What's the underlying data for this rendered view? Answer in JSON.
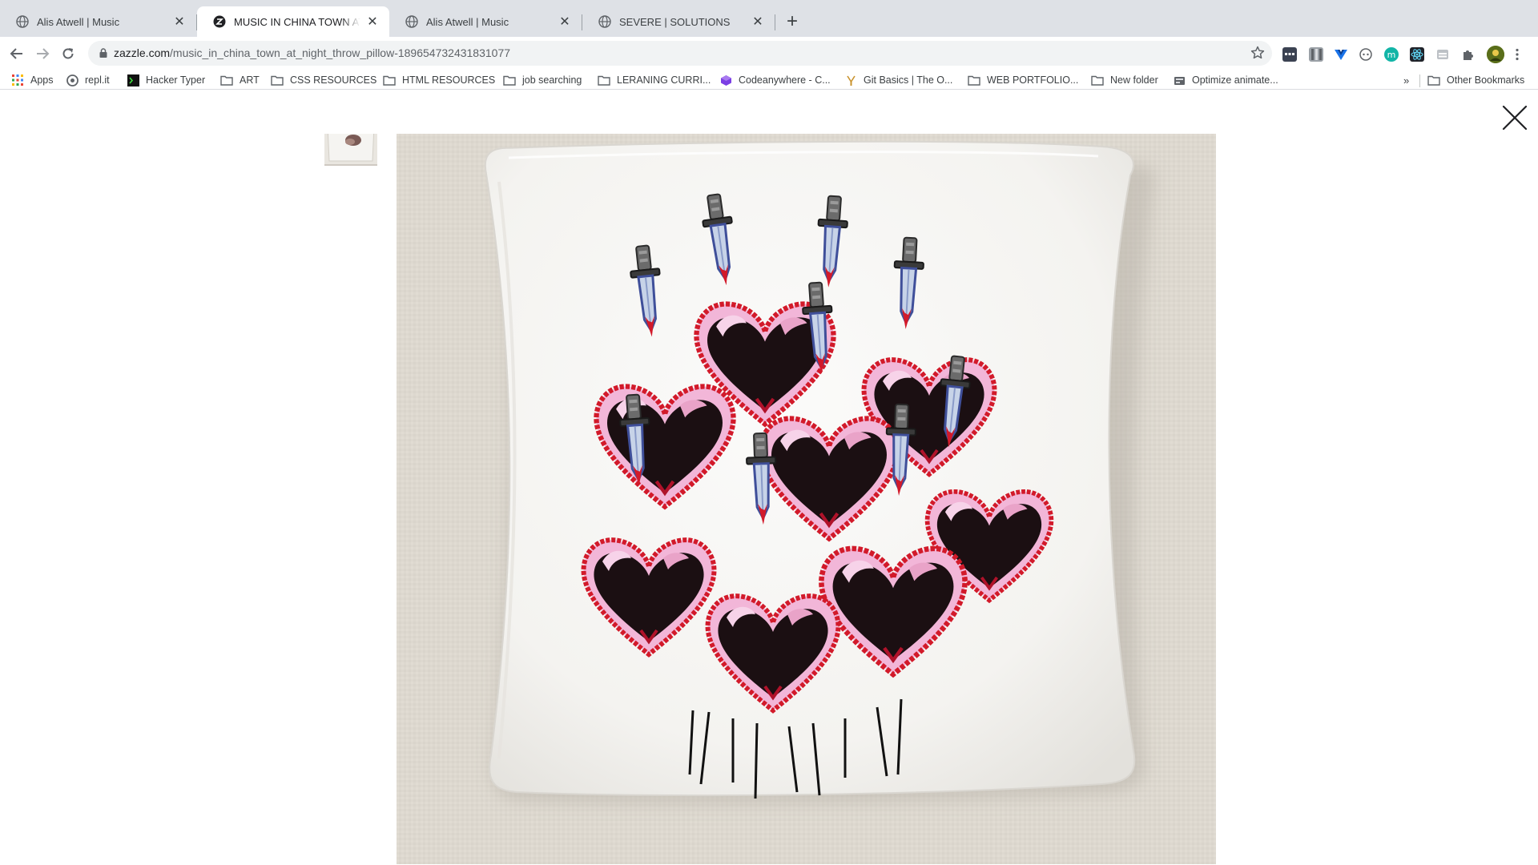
{
  "browser": {
    "tabs": [
      {
        "title": "Alis Atwell | Music",
        "active": false,
        "favicon": "globe-icon"
      },
      {
        "title": "MUSIC IN CHINA TOWN AT NIGHT",
        "active": true,
        "favicon": "zazzle-icon"
      },
      {
        "title": "Alis Atwell | Music",
        "active": false,
        "favicon": "globe-icon"
      },
      {
        "title": "SEVERE | SOLUTIONS",
        "active": false,
        "favicon": "globe-icon"
      }
    ],
    "url_host": "zazzle.com",
    "url_path": "/music_in_china_town_at_night_throw_pillow-189654732431831077",
    "bookmarks": [
      {
        "label": "Apps",
        "icon": "apps-grid-icon"
      },
      {
        "label": "repl.it",
        "icon": "replit-icon"
      },
      {
        "label": "Hacker Typer",
        "icon": "terminal-icon"
      },
      {
        "label": "ART",
        "icon": "folder-icon"
      },
      {
        "label": "CSS RESOURCES",
        "icon": "folder-icon"
      },
      {
        "label": "HTML RESOURCES",
        "icon": "folder-icon"
      },
      {
        "label": "job searching",
        "icon": "folder-icon"
      },
      {
        "label": "LERANING CURRI...",
        "icon": "folder-icon"
      },
      {
        "label": "Codeanywhere - C...",
        "icon": "cube-icon"
      },
      {
        "label": "Git Basics | The O...",
        "icon": "odin-icon"
      },
      {
        "label": "WEB PORTFOLIO...",
        "icon": "folder-icon"
      },
      {
        "label": "New folder",
        "icon": "folder-icon"
      },
      {
        "label": "Optimize animate...",
        "icon": "optimize-icon"
      }
    ],
    "overflow_label": "»",
    "other_bookmarks": "Other Bookmarks"
  },
  "viewer": {
    "product_image": "throw-pillow-hearts-daggers",
    "close_icon": "close-icon"
  },
  "colors": {
    "tabstrip": "#dee1e6",
    "omnibox": "#f1f3f4",
    "canvas_bg": "#ddd8cf",
    "pillow": "#f7f6f3",
    "heart_dark": "#1b0f12",
    "heart_outline": "#d21a2a",
    "heart_pink": "#f2b6d8"
  }
}
